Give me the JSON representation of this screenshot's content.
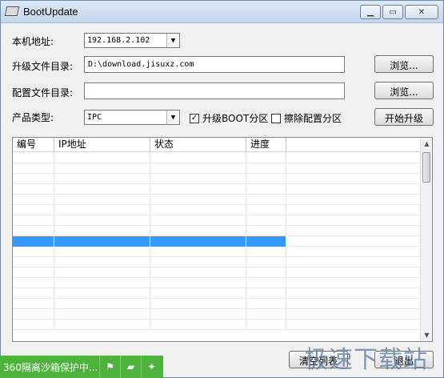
{
  "window": {
    "title": "BootUpdate"
  },
  "form": {
    "local_addr_label": "本机地址:",
    "local_addr_value": "192.168.2.102",
    "upgrade_dir_label": "升级文件目录:",
    "upgrade_dir_value": "D:\\download.jisuxz.com",
    "config_dir_label": "配置文件目录:",
    "config_dir_value": "",
    "product_type_label": "产品类型:",
    "product_type_value": "IPC",
    "browse_label": "浏览...",
    "upgrade_boot_label": "升级BOOT分区",
    "upgrade_boot_checked": true,
    "erase_config_label": "擦除配置分区",
    "erase_config_checked": false,
    "start_upgrade_label": "开始升级"
  },
  "table": {
    "columns": [
      "编号",
      "IP地址",
      "状态",
      "进度"
    ],
    "rows": [
      [],
      [],
      [],
      [],
      [],
      [],
      [],
      [],
      [],
      [],
      [],
      [],
      [],
      [],
      [],
      [],
      []
    ],
    "selected_row_index": 8
  },
  "footer": {
    "clear_button_label": "清空列表",
    "exit_button_label": "退出"
  },
  "taskbar": {
    "sandbox_text": "360隔离沙箱保护中..."
  },
  "watermark": {
    "text": "极速下载站"
  },
  "colors": {
    "selection": "#3399ff",
    "sandbox_bar": "#4eb33c"
  }
}
